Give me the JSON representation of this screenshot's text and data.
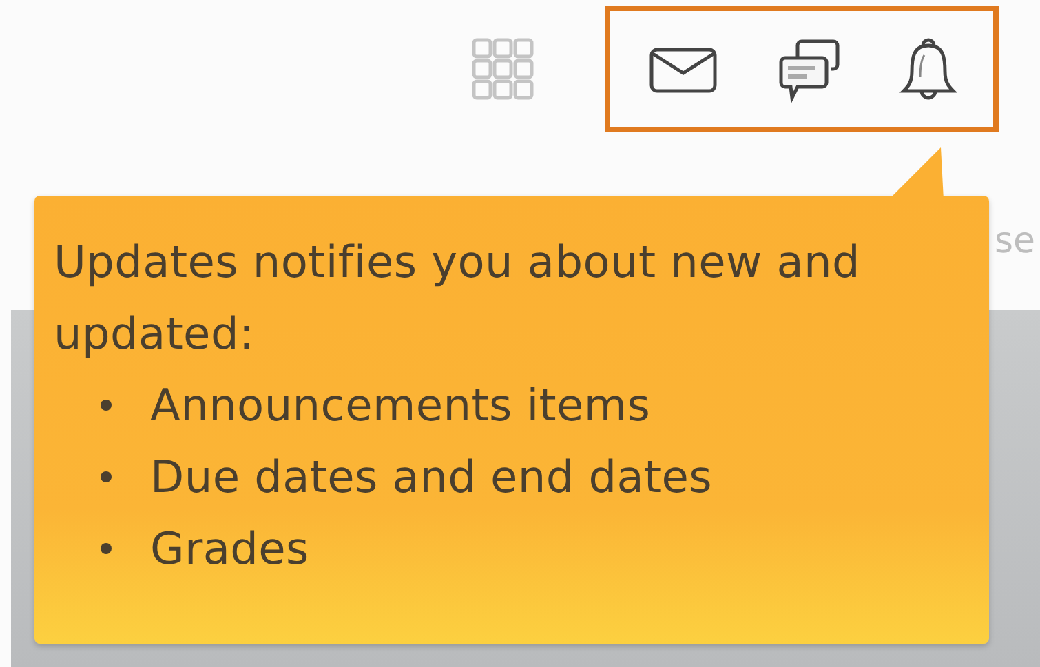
{
  "header": {
    "toolbar_highlighted": true,
    "partial_text": "se"
  },
  "tooltip": {
    "text": "Updates notifies you about new and updated:",
    "items": [
      "Announcements items",
      "Due dates and end dates",
      "Grades"
    ]
  }
}
